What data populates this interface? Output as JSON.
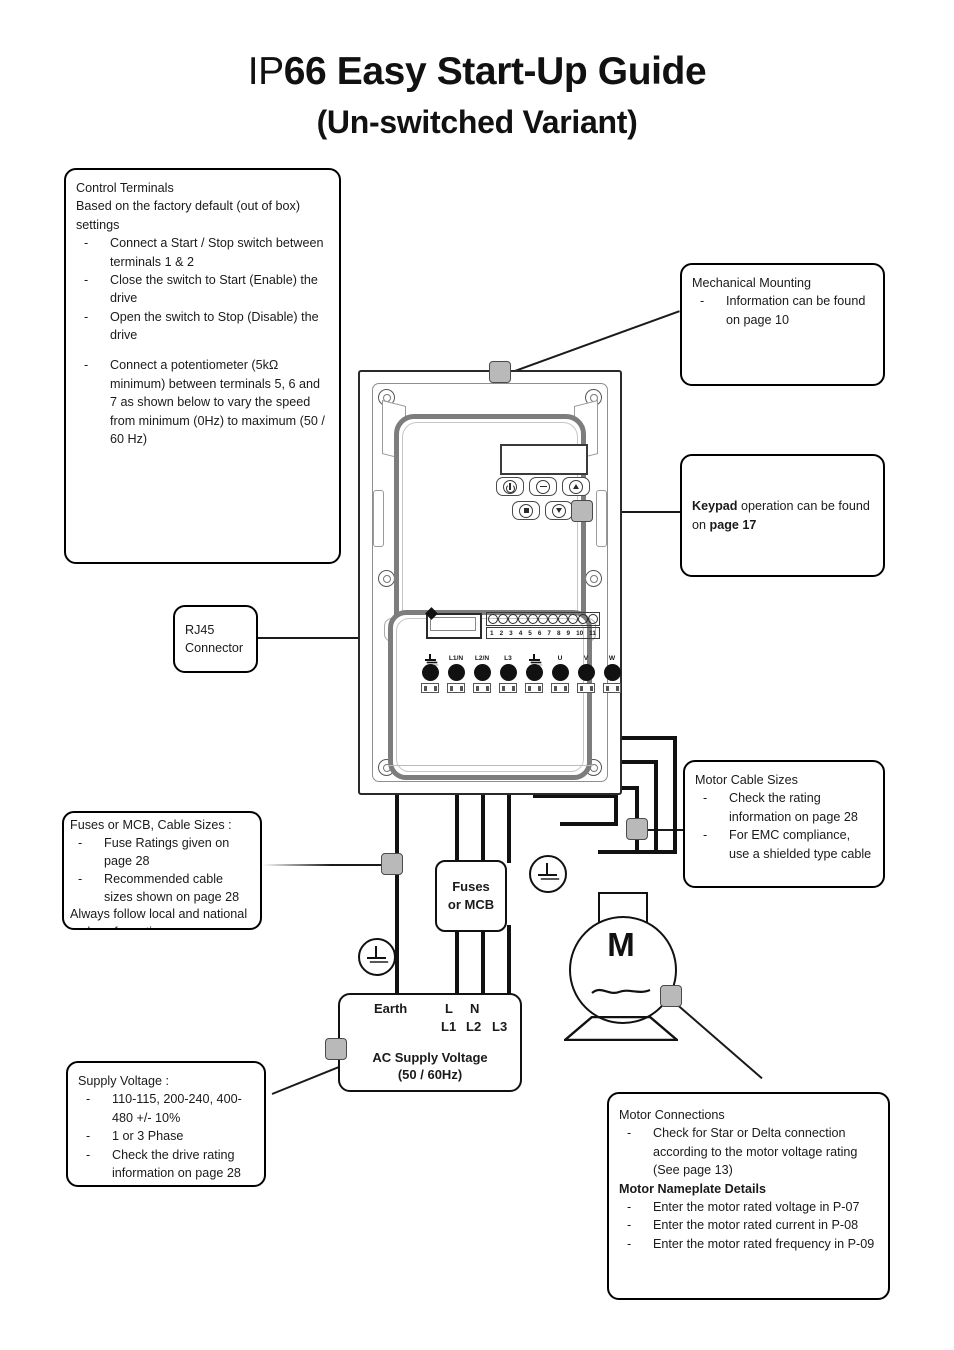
{
  "title": {
    "main_prefix": "IP",
    "main_rest": "66 Easy Start-Up Guide",
    "sub": "(Un-switched Variant)"
  },
  "control_terminals": {
    "heading": "Control Terminals",
    "intro": "Based on the factory default (out of box) settings",
    "bullets": [
      "Connect a Start / Stop switch between terminals 1 & 2",
      "Close the switch to Start (Enable) the drive",
      "Open the switch to Stop (Disable) the drive"
    ],
    "bullets2": [
      "Connect a potentiometer (5kΩ minimum) between terminals 5, 6 and 7 as shown below to vary the speed from minimum (0Hz) to maximum (50 / 60 Hz)"
    ],
    "terminal_block_a": [
      "1",
      "2"
    ],
    "terminal_block_b": [
      "5",
      "6",
      "7"
    ]
  },
  "mechanical_mounting": {
    "heading": "Mechanical Mounting",
    "bullets": [
      "Information can be found on page 10"
    ]
  },
  "keypad_note": {
    "bold1": "Keypad",
    "text1": " operation can be found on ",
    "bold2": "page 17"
  },
  "rj45": {
    "line1": "RJ45",
    "line2": "Connector"
  },
  "motor_cable_sizes": {
    "heading": "Motor Cable Sizes",
    "bullets": [
      "Check the rating information on page 28",
      "For EMC compliance, use a shielded type cable"
    ]
  },
  "fuses_mcb": {
    "heading": "Fuses or MCB, Cable Sizes :",
    "bullets": [
      "Fuse Ratings given on page 28",
      "Recommended cable sizes shown on page 28"
    ],
    "footer": "Always follow local and national codes of practice"
  },
  "supply_voltage": {
    "heading": "Supply Voltage :",
    "bullets": [
      "110-115, 200-240, 400-480 +/- 10%",
      "1 or 3 Phase",
      "Check the drive rating information on page 28"
    ]
  },
  "motor_connections": {
    "heading": "Motor Connections",
    "bullets": [
      "Check for Star or Delta connection according to the motor voltage rating (See page 13)"
    ],
    "subheading": "Motor Nameplate Details",
    "bullets2": [
      "Enter the motor rated voltage in P-07",
      "Enter the motor rated current in P-08",
      "Enter the motor rated frequency in P-09"
    ]
  },
  "drive": {
    "power_terminals": [
      "⏚",
      "L1/N",
      "L2/N",
      "L3",
      "⏚",
      "U",
      "V",
      "W"
    ],
    "control_terminal_numbers": [
      "1",
      "2",
      "3",
      "4",
      "5",
      "6",
      "7",
      "8",
      "9",
      "10",
      "11"
    ]
  },
  "fuse_box": {
    "line1": "Fuses",
    "line2": "or MCB"
  },
  "ac_supply": {
    "earth": "Earth",
    "l": "L",
    "n": "N",
    "l1": "L1",
    "l2": "L2",
    "l3": "L3",
    "title": "AC Supply Voltage",
    "freq": "(50 / 60Hz)"
  },
  "motor": {
    "label": "M"
  },
  "colors": {
    "line": "#111111",
    "nub": "#b9b9b9",
    "frame": "#7d7d7d"
  }
}
